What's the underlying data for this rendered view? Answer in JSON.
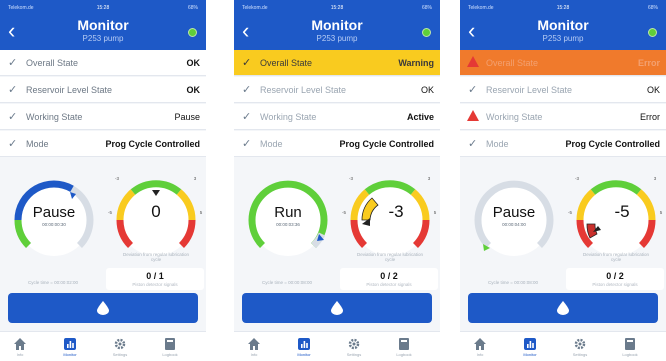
{
  "status_bar": {
    "carrier": "Telekom.de",
    "time": "15:28",
    "battery": "68%"
  },
  "header": {
    "title": "Monitor",
    "subtitle": "P253 pump"
  },
  "tabs": [
    "Info",
    "Monitor",
    "Settings",
    "Logbook"
  ],
  "colors": {
    "brand": "#1e59c7",
    "ok": "#5fcf3a",
    "warning": "#f9cb1f",
    "error": "#e53935",
    "alarm_row": "#f07a2c"
  },
  "screens": [
    {
      "rows": [
        {
          "label": "Overall State",
          "value": "OK",
          "state": "normal"
        },
        {
          "label": "Reservoir Level State",
          "value": "OK",
          "state": "normal"
        },
        {
          "label": "Working State",
          "value": "Pause",
          "state": "normal"
        },
        {
          "label": "Mode",
          "value": "Prog Cycle Controlled",
          "state": "normal"
        }
      ],
      "left_gauge": {
        "label": "Pause",
        "timer": "00:00:00:30"
      },
      "right_gauge": {
        "value": "0",
        "deviation": 0
      },
      "scale": {
        "min_label": "-5",
        "top_left": "-3",
        "top_right": "3",
        "max_label": "5"
      },
      "cycle_time": "Cycle time = 00:00:02:00",
      "deviation_caption": "Deviation from regular lubrication cycle",
      "ratio": "0 / 1",
      "ratio_caption": "Piston detector signals"
    },
    {
      "rows": [
        {
          "label": "Overall State",
          "value": "Warning",
          "state": "warning"
        },
        {
          "label": "Reservoir Level State",
          "value": "OK",
          "state": "normal"
        },
        {
          "label": "Working State",
          "value": "Active",
          "state": "normal"
        },
        {
          "label": "Mode",
          "value": "Prog Cycle Controlled",
          "state": "normal"
        }
      ],
      "left_gauge": {
        "label": "Run",
        "timer": "00:00:03:36"
      },
      "right_gauge": {
        "value": "-3",
        "deviation": -3
      },
      "scale": {
        "min_label": "-5",
        "top_left": "-3",
        "top_right": "3",
        "max_label": "5"
      },
      "cycle_time": "Cycle time = 00:00:08:00",
      "deviation_caption": "Deviation from regular lubrication cycle",
      "ratio": "0 / 2",
      "ratio_caption": "Piston detector signals"
    },
    {
      "rows": [
        {
          "label": "Overall State",
          "value": "Error",
          "state": "error"
        },
        {
          "label": "Reservoir Level State",
          "value": "OK",
          "state": "normal"
        },
        {
          "label": "Working State",
          "value": "Error",
          "state": "alarm"
        },
        {
          "label": "Mode",
          "value": "Prog Cycle Controlled",
          "state": "normal"
        }
      ],
      "left_gauge": {
        "label": "Pause",
        "timer": "00:00:04:00"
      },
      "right_gauge": {
        "value": "-5",
        "deviation": -5
      },
      "scale": {
        "min_label": "-5",
        "top_left": "-3",
        "top_right": "3",
        "max_label": "5"
      },
      "cycle_time": "Cycle time = 00:00:08:00",
      "deviation_caption": "Deviation from regular lubrication cycle",
      "ratio": "0 / 2",
      "ratio_caption": "Piston detector signals"
    }
  ]
}
